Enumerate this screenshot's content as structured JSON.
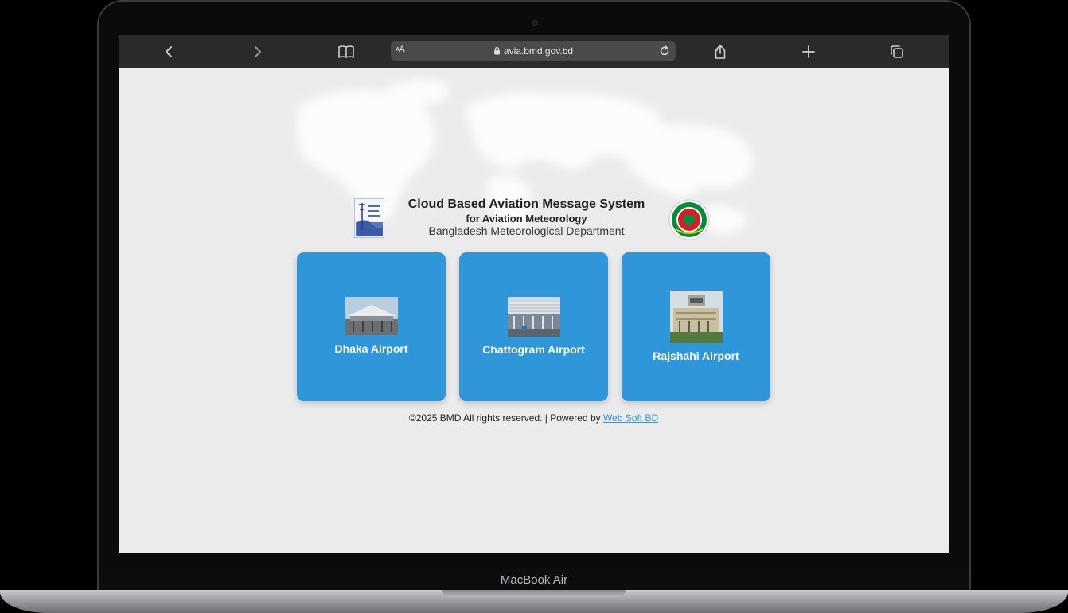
{
  "device": {
    "brand_label": "MacBook Air"
  },
  "browser": {
    "url": "avia.bmd.gov.bd",
    "aa_label_big": "A",
    "aa_label_small": "A",
    "icons": [
      "back-icon",
      "forward-icon",
      "bookmarks-icon",
      "text-size-icon",
      "lock-icon",
      "reload-icon",
      "share-icon",
      "new-tab-icon",
      "tabs-icon"
    ]
  },
  "header": {
    "title": "Cloud Based Aviation Message System",
    "subtitle": "for Aviation Meteorology",
    "department": "Bangladesh Meteorological Department"
  },
  "cards": [
    {
      "label": "Dhaka Airport"
    },
    {
      "label": "Chattogram Airport"
    },
    {
      "label": "Rajshahi Airport"
    }
  ],
  "footer": {
    "copyright": "©2025 BMD All rights reserved. | Powered by",
    "link_text": "Web Soft BD"
  },
  "colors": {
    "card_bg": "#2f96d9",
    "link": "#2f96d9",
    "page_bg": "#ebebeb",
    "toolbar_bg": "#2a2a2c"
  }
}
